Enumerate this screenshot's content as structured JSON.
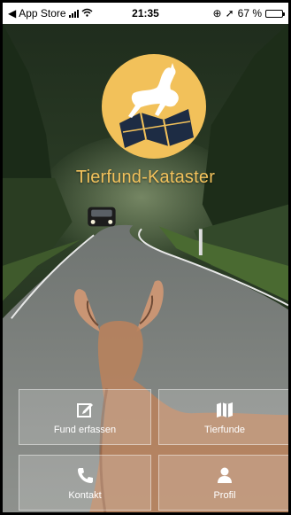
{
  "status_bar": {
    "back_label": "App Store",
    "time": "21:35",
    "battery": "67 %"
  },
  "app": {
    "title": "Tierfund-Kataster"
  },
  "actions": [
    {
      "label": "Fund erfassen",
      "icon": "edit-icon"
    },
    {
      "label": "Tierfunde",
      "icon": "map-icon"
    },
    {
      "label": "Kontakt",
      "icon": "phone-icon"
    },
    {
      "label": "Profil",
      "icon": "user-icon"
    }
  ],
  "colors": {
    "accent": "#f2c15a"
  }
}
